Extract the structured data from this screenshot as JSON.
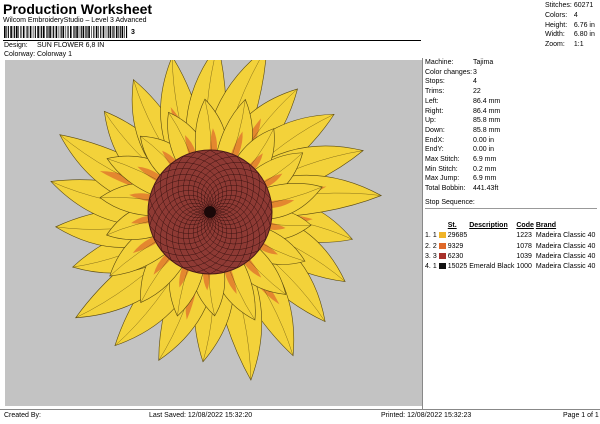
{
  "header": {
    "title": "Production Worksheet",
    "subtitle": "Wilcom EmbroideryStudio – Level 3 Advanced",
    "barcode_number": "3"
  },
  "design_info": {
    "design_label": "Design:",
    "design_value": "SUN FLOWER 6,8 IN",
    "colorway_label": "Colorway:",
    "colorway_value": "Colorway 1"
  },
  "top_right": {
    "stitches_label": "Stitches:",
    "stitches": "60271",
    "colors_label": "Colors:",
    "colors": "4",
    "height_label": "Height:",
    "height": "6.76 in",
    "width_label": "Width:",
    "width": "6.80 in",
    "zoom_label": "Zoom:",
    "zoom": "1:1"
  },
  "machine_info": {
    "machine_label": "Machine:",
    "machine": "Tajima",
    "color_changes_label": "Color changes:",
    "color_changes": "3",
    "stops_label": "Stops:",
    "stops": "4",
    "trims_label": "Trims:",
    "trims": "22",
    "left_label": "Left:",
    "left": "86.4 mm",
    "right_label": "Right:",
    "right": "86.4 mm",
    "up_label": "Up:",
    "up": "85.8 mm",
    "down_label": "Down:",
    "down": "85.8 mm",
    "endx_label": "EndX:",
    "endx": "0.00 in",
    "endy_label": "EndY:",
    "endy": "0.00 in",
    "max_stitch_label": "Max Stitch:",
    "max_stitch": "6.9 mm",
    "min_stitch_label": "Min Stitch:",
    "min_stitch": "0.2 mm",
    "max_jump_label": "Max Jump:",
    "max_jump": "6.9 mm",
    "total_bobbin_label": "Total Bobbin:",
    "total_bobbin": "441.43ft"
  },
  "stop_sequence": {
    "label": "Stop Sequence:",
    "headers": {
      "st": "St.",
      "description": "Description",
      "code": "Code",
      "brand": "Brand"
    },
    "rows": [
      {
        "num": "1.",
        "stop": "1",
        "color": "#f0b429",
        "st": "29685",
        "description": "",
        "code": "1223",
        "brand": "Madeira Classic 40"
      },
      {
        "num": "2.",
        "stop": "2",
        "color": "#e0692a",
        "st": "9329",
        "description": "",
        "code": "1078",
        "brand": "Madeira Classic 40"
      },
      {
        "num": "3.",
        "stop": "3",
        "color": "#a8312b",
        "st": "6230",
        "description": "",
        "code": "1039",
        "brand": "Madeira Classic 40"
      },
      {
        "num": "4.",
        "stop": "1",
        "color": "#111111",
        "st": "15025",
        "description": "Emerald Black",
        "code": "1000",
        "brand": "Madeira Classic 40"
      }
    ]
  },
  "footer": {
    "created_by": "Created By:",
    "last_saved": "Last Saved: 12/08/2022 15:32:20",
    "printed": "Printed: 12/08/2022 15:32:23",
    "page": "Page 1 of 1"
  },
  "colors": {
    "canvas_bg": "#c3c3c3",
    "petal_yellow": "#f3d23a",
    "petal_orange": "#e07a2e",
    "center": "#8e3a34"
  }
}
